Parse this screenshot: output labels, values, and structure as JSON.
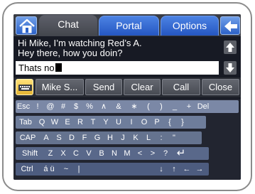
{
  "tabs": [
    {
      "label": "Chat"
    },
    {
      "label": "Portal"
    },
    {
      "label": "Options"
    }
  ],
  "chat": {
    "lines": [
      "Hi Mike, I’m watching Red’s A.",
      "Hey there, how you doin?"
    ],
    "input_value": "Thats no"
  },
  "actions": {
    "recipient_label": "Mike S...",
    "send_label": "Send",
    "clear_label": "Clear",
    "call_label": "Call",
    "close_label": "Close"
  },
  "keyboard": {
    "rows": [
      [
        "Esc",
        "!",
        "@",
        "#",
        "$",
        "%",
        "∧",
        "&",
        "∗",
        "(",
        ")",
        "_",
        "+",
        "Del"
      ],
      [
        "Tab",
        "Q",
        "W",
        "E",
        "R",
        "T",
        "Y",
        "U",
        "I",
        "O",
        "P",
        "{",
        "}"
      ],
      [
        "CAP",
        "A",
        "S",
        "D",
        "F",
        "G",
        "H",
        "J",
        "K",
        "L",
        ":",
        "\""
      ],
      [
        "Shift",
        "Z",
        "X",
        "C",
        "V",
        "B",
        "N",
        "M",
        "<",
        ">",
        "?",
        "↵"
      ],
      [
        "Ctrl",
        "á ü",
        "~",
        "|",
        "",
        "↓",
        "↑",
        "←",
        "→"
      ]
    ]
  },
  "colors": {
    "accent_blue": "#2d62c8",
    "keyboard_toggle": "#e4b432",
    "background": "#171a24"
  }
}
